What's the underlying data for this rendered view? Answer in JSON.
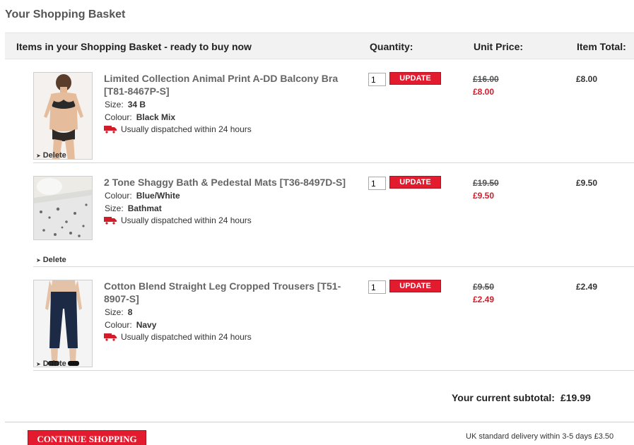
{
  "page": {
    "title": "Your Shopping Basket"
  },
  "header": {
    "items": "Items in your Shopping Basket - ready to buy now",
    "quantity": "Quantity:",
    "unit_price": "Unit Price:",
    "item_total": "Item Total:"
  },
  "items": [
    {
      "name": "Limited Collection Animal Print A-DD Balcony Bra [T81-8467P-S]",
      "attrs": [
        {
          "label": "Size:",
          "value": "34 B"
        },
        {
          "label": "Colour:",
          "value": "Black Mix"
        }
      ],
      "dispatch": "Usually dispatched within 24 hours",
      "quantity": "1",
      "update_label": "UPDATE",
      "was_price": "£16.00",
      "now_price": "£8.00",
      "total": "£8.00",
      "delete_label": "Delete"
    },
    {
      "name": "2 Tone Shaggy Bath & Pedestal Mats [T36-8497D-S]",
      "attrs": [
        {
          "label": "Colour:",
          "value": "Blue/White"
        },
        {
          "label": "Size:",
          "value": "Bathmat"
        }
      ],
      "dispatch": "Usually dispatched within 24 hours",
      "quantity": "1",
      "update_label": "UPDATE",
      "was_price": "£19.50",
      "now_price": "£9.50",
      "total": "£9.50",
      "delete_label": "Delete"
    },
    {
      "name": "Cotton Blend Straight Leg Cropped Trousers [T51-8907-S]",
      "attrs": [
        {
          "label": "Size:",
          "value": "8"
        },
        {
          "label": "Colour:",
          "value": "Navy"
        }
      ],
      "dispatch": "Usually dispatched within 24 hours",
      "quantity": "1",
      "update_label": "UPDATE",
      "was_price": "£9.50",
      "now_price": "£2.49",
      "total": "£2.49",
      "delete_label": "Delete"
    }
  ],
  "summary": {
    "subtotal_label": "Your current subtotal:",
    "subtotal_value": "£19.99",
    "continue_label": "CONTINUE SHOPPING",
    "delivery_note": "UK standard delivery within 3-5 days £3.50"
  },
  "colors": {
    "accent": "#e31b2f",
    "sale_price": "#d21c2a"
  },
  "icons": {
    "dispatch": "truck-icon",
    "delete": "arrow-right-icon"
  }
}
